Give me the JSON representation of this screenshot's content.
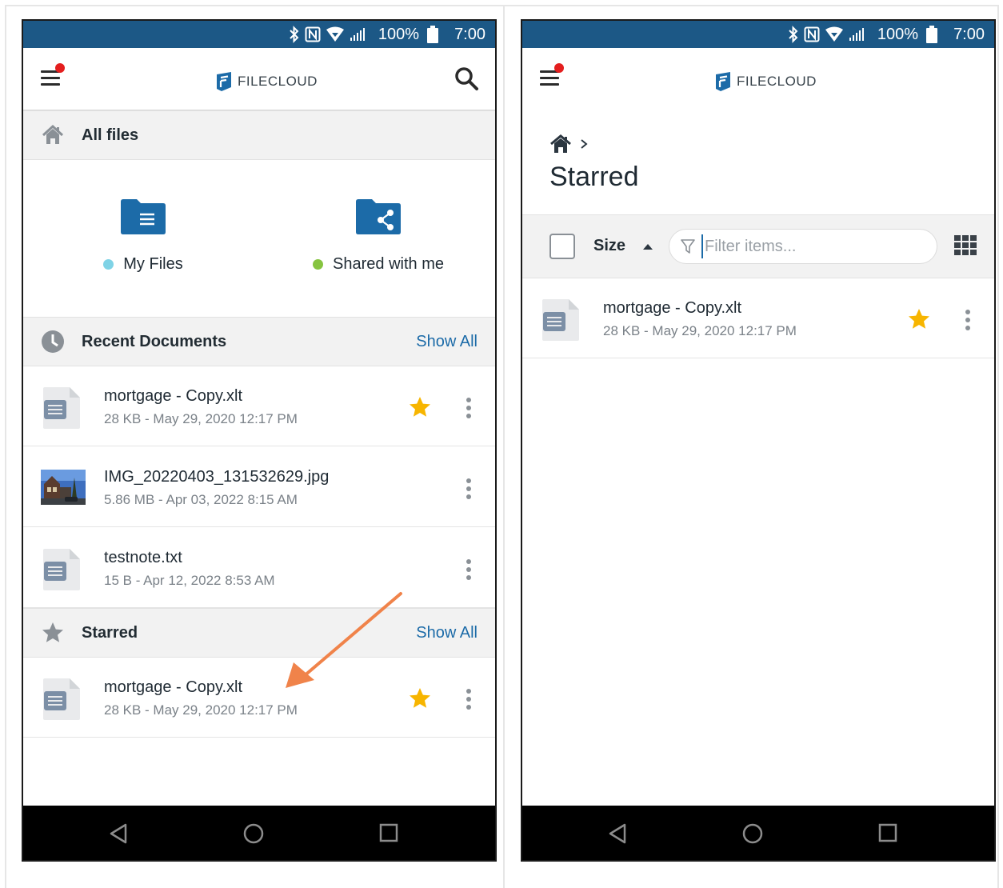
{
  "colors": {
    "status_bar": "#1c5886",
    "link": "#1c6ba8",
    "star": "#f7b500",
    "folder": "#1c6ba8",
    "notification_dot": "#e41e1e",
    "my_files_bullet": "#7fd3e6",
    "shared_bullet": "#86c440",
    "arrow": "#f0834a"
  },
  "status_bar": {
    "battery": "100%",
    "time": "7:00"
  },
  "app": {
    "logo_text": "FILECLOUD"
  },
  "left": {
    "all_files_label": "All files",
    "folders": [
      {
        "label": "My Files",
        "icon": "folder-documents-icon"
      },
      {
        "label": "Shared with me",
        "icon": "folder-shared-icon"
      }
    ],
    "recent": {
      "title": "Recent Documents",
      "action": "Show All",
      "items": [
        {
          "name": "mortgage - Copy.xlt",
          "meta": "28 KB - May 29, 2020 12:17 PM",
          "starred": true,
          "icon": "document-icon"
        },
        {
          "name": "IMG_20220403_131532629.jpg",
          "meta": "5.86 MB - Apr 03, 2022 8:15 AM",
          "starred": false,
          "icon": "image-thumbnail"
        },
        {
          "name": "testnote.txt",
          "meta": "15 B - Apr 12, 2022 8:53 AM",
          "starred": false,
          "icon": "document-icon"
        }
      ]
    },
    "starred": {
      "title": "Starred",
      "action": "Show All",
      "items": [
        {
          "name": "mortgage - Copy.xlt",
          "meta": "28 KB - May 29, 2020 12:17 PM",
          "starred": true,
          "icon": "document-icon"
        }
      ]
    }
  },
  "right": {
    "page_title": "Starred",
    "sort_label": "Size",
    "filter_placeholder": "Filter items...",
    "items": [
      {
        "name": "mortgage - Copy.xlt",
        "meta": "28 KB - May 29, 2020 12:17 PM",
        "starred": true,
        "icon": "document-icon"
      }
    ]
  }
}
